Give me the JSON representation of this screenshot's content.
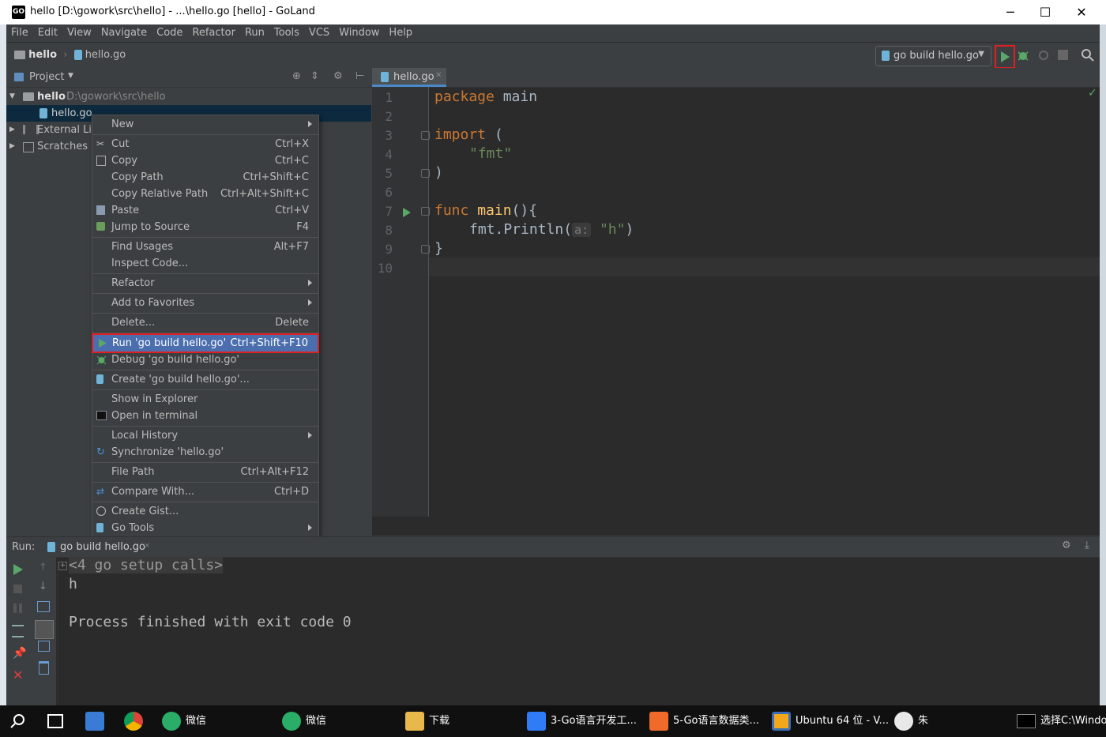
{
  "window": {
    "title": "hello [D:\\gowork\\src\\hello] - ...\\hello.go [hello] - GoLand",
    "app_icon": "GO",
    "minimize": "─",
    "maximize": "☐",
    "close": "✕"
  },
  "menu": [
    "File",
    "Edit",
    "View",
    "Navigate",
    "Code",
    "Refactor",
    "Run",
    "Tools",
    "VCS",
    "Window",
    "Help"
  ],
  "breadcrumb": {
    "project": "hello",
    "file": "hello.go"
  },
  "toolbar": {
    "run_config": "go build hello.go"
  },
  "project_panel": {
    "title": "Project",
    "root_name": "hello",
    "root_path": "D:\\gowork\\src\\hello",
    "file": "hello.go",
    "external": "External Libr",
    "scratches": "Scratches ar"
  },
  "editor": {
    "tab": "hello.go",
    "line_numbers": [
      "1",
      "2",
      "3",
      "4",
      "5",
      "6",
      "7",
      "8",
      "9",
      "10"
    ],
    "code": {
      "l1_kw": "package",
      "l1_rest": " main",
      "l3_kw": "import",
      "l3_rest": " (",
      "l4_str": "\"fmt\"",
      "l5": ")",
      "l7_kw": "func",
      "l7_fn": " main",
      "l7_rest": "(){",
      "l8_call": "fmt.Println(",
      "l8_hint": "a:",
      "l8_str": "\"h\"",
      "l8_end": ")",
      "l9": "}"
    }
  },
  "context_menu": [
    {
      "label": "New",
      "shortcut": "",
      "submenu": true
    },
    {
      "label": "Cut",
      "shortcut": "Ctrl+X"
    },
    {
      "label": "Copy",
      "shortcut": "Ctrl+C"
    },
    {
      "label": "Copy Path",
      "shortcut": "Ctrl+Shift+C"
    },
    {
      "label": "Copy Relative Path",
      "shortcut": "Ctrl+Alt+Shift+C"
    },
    {
      "label": "Paste",
      "shortcut": "Ctrl+V"
    },
    {
      "label": "Jump to Source",
      "shortcut": "F4"
    },
    {
      "label": "Find Usages",
      "shortcut": "Alt+F7"
    },
    {
      "label": "Inspect Code...",
      "shortcut": ""
    },
    {
      "label": "Refactor",
      "shortcut": "",
      "submenu": true
    },
    {
      "label": "Add to Favorites",
      "shortcut": "",
      "submenu": true
    },
    {
      "label": "Delete...",
      "shortcut": "Delete"
    },
    {
      "label": "Run 'go build hello.go'",
      "shortcut": "Ctrl+Shift+F10"
    },
    {
      "label": "Debug 'go build hello.go'",
      "shortcut": ""
    },
    {
      "label": "Create 'go build hello.go'...",
      "shortcut": ""
    },
    {
      "label": "Show in Explorer",
      "shortcut": ""
    },
    {
      "label": "Open in terminal",
      "shortcut": ""
    },
    {
      "label": "Local History",
      "shortcut": "",
      "submenu": true
    },
    {
      "label": "Synchronize 'hello.go'",
      "shortcut": ""
    },
    {
      "label": "File Path",
      "shortcut": "Ctrl+Alt+F12"
    },
    {
      "label": "Compare With...",
      "shortcut": "Ctrl+D"
    },
    {
      "label": "Create Gist...",
      "shortcut": ""
    },
    {
      "label": "Go Tools",
      "shortcut": "",
      "submenu": true
    }
  ],
  "run_panel": {
    "label": "Run:",
    "tab": "go build hello.go",
    "output": [
      "<4 go setup calls>",
      "h",
      "",
      "Process finished with exit code 0"
    ]
  },
  "taskbar": [
    {
      "label": "",
      "icon": "search-icon"
    },
    {
      "label": "",
      "icon": "task-view-icon"
    },
    {
      "label": "",
      "icon": "app-icon"
    },
    {
      "label": "",
      "icon": "chrome-icon"
    },
    {
      "label": "微信",
      "icon": "wechat-icon"
    },
    {
      "label": "微信",
      "icon": "wechat-icon"
    },
    {
      "label": "下载",
      "icon": "folder-icon"
    },
    {
      "label": "3-Go语言开发工...",
      "icon": "wps-icon"
    },
    {
      "label": "5-Go语言数据类...",
      "icon": "ppt-icon"
    },
    {
      "label": "Ubuntu 64 位 - V...",
      "icon": "vmware-icon"
    },
    {
      "label": "朱",
      "icon": "avatar-icon"
    },
    {
      "label": "选择C:\\Window",
      "icon": "cmd-icon"
    }
  ],
  "colors": {
    "bg": "#3c3f41",
    "editor_bg": "#2b2b2b",
    "keyword": "#cc7832",
    "string": "#6a8759",
    "function": "#ffc66d",
    "selection": "#4b6eaf",
    "highlight_border": "#e02020",
    "run_green": "#59a869"
  }
}
